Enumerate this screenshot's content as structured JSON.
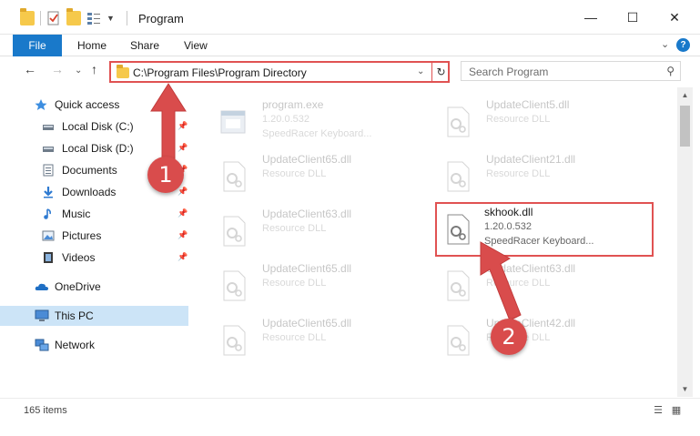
{
  "window": {
    "title": "Program",
    "min_glyph": "—",
    "max_glyph": "☐",
    "close_glyph": "✕"
  },
  "ribbon": {
    "tabs": [
      "File",
      "Home",
      "Share",
      "View"
    ],
    "collapse_glyph": "⌄",
    "help_glyph": "?"
  },
  "address": {
    "path": "C:\\Program Files\\Program Directory",
    "dropdown_glyph": "⌄",
    "refresh_glyph": "↻"
  },
  "search": {
    "placeholder": "Search Program",
    "icon_glyph": "⚲"
  },
  "nav_glyphs": {
    "back": "←",
    "forward": "→",
    "dropdown": "⌄",
    "up": "↑"
  },
  "navpane": {
    "items": [
      {
        "label": "Quick access",
        "icon": "star-icon",
        "pinned": false
      },
      {
        "label": "Local Disk (C:)",
        "icon": "drive-icon",
        "pinned": true
      },
      {
        "label": "Local Disk (D:)",
        "icon": "drive-icon",
        "pinned": true
      },
      {
        "label": "Documents",
        "icon": "documents-icon",
        "pinned": true
      },
      {
        "label": "Downloads",
        "icon": "downloads-icon",
        "pinned": true
      },
      {
        "label": "Music",
        "icon": "music-icon",
        "pinned": true
      },
      {
        "label": "Pictures",
        "icon": "pictures-icon",
        "pinned": true
      },
      {
        "label": "Videos",
        "icon": "videos-icon",
        "pinned": true
      },
      {
        "label": "OneDrive",
        "icon": "cloud-icon",
        "pinned": false
      },
      {
        "label": "This PC",
        "icon": "pc-icon",
        "pinned": false,
        "selected": true
      },
      {
        "label": "Network",
        "icon": "network-icon",
        "pinned": false
      }
    ],
    "pin_glyph": "📌"
  },
  "files": [
    {
      "name": "program.exe",
      "line2": "1.20.0.532",
      "line3": "SpeedRacer Keyboard..."
    },
    {
      "name": "UpdateClient5.dll",
      "line2": "Resource DLL",
      "line3": ""
    },
    {
      "name": "UpdateClient65.dll",
      "line2": "Resource DLL",
      "line3": ""
    },
    {
      "name": "UpdateClient21.dll",
      "line2": "Resource DLL",
      "line3": ""
    },
    {
      "name": "UpdateClient63.dll",
      "line2": "Resource DLL",
      "line3": ""
    },
    {
      "name": "skhook.dll",
      "line2": "1.20.0.532",
      "line3": "SpeedRacer Keyboard...",
      "highlighted": true
    },
    {
      "name": "UpdateClient65.dll",
      "line2": "Resource DLL",
      "line3": ""
    },
    {
      "name": "UpdateClient63.dll",
      "line2": "Resource DLL",
      "line3": ""
    },
    {
      "name": "UpdateClient65.dll",
      "line2": "Resource DLL",
      "line3": ""
    },
    {
      "name": "UpdateClient42.dll",
      "line2": "Resource DLL",
      "line3": ""
    }
  ],
  "scroll": {
    "up_glyph": "▲",
    "down_glyph": "▼"
  },
  "status": {
    "count": "165 items",
    "details_glyph": "☰",
    "tiles_glyph": "▦"
  },
  "annotations": {
    "badge1": "1",
    "badge2": "2",
    "color": "#d94c4c"
  },
  "colors": {
    "accent": "#1979ca",
    "highlight": "#e05252",
    "selected_bg": "#cce4f7"
  }
}
